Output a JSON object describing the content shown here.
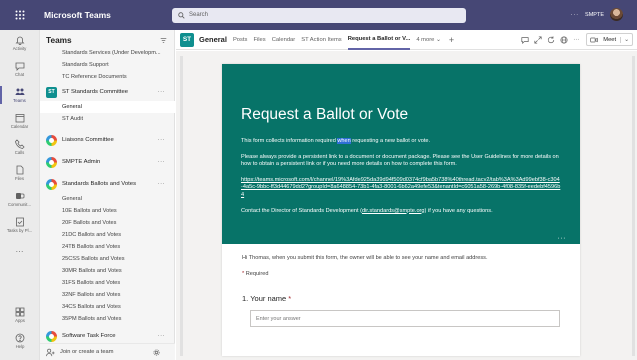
{
  "app": {
    "name": "Microsoft Teams"
  },
  "search": {
    "placeholder": "Search"
  },
  "titlebar": {
    "more": "···",
    "org": "SMPTE"
  },
  "rail": [
    {
      "label": "Activity"
    },
    {
      "label": "Chat"
    },
    {
      "label": "Teams"
    },
    {
      "label": "Calendar"
    },
    {
      "label": "Calls"
    },
    {
      "label": "Files"
    },
    {
      "label": "Communit..."
    },
    {
      "label": "Tasks by Pl..."
    },
    {
      "label": "···"
    }
  ],
  "rail_bottom": [
    {
      "label": "Apps"
    },
    {
      "label": "Help"
    }
  ],
  "panel": {
    "title": "Teams",
    "footer": "Join or create a team",
    "top_channels": [
      "Standards Services (Under Developm...",
      "Standards Support",
      "TC Reference Documents"
    ],
    "teams": [
      {
        "name": "ST Standards Committee",
        "avatar": "ST",
        "channels": [
          "General",
          "ST Audit"
        ],
        "selected": "General"
      },
      {
        "name": "Liaisons Committee",
        "channels": []
      },
      {
        "name": "SMPTE Admin",
        "channels": []
      },
      {
        "name": "Standards Ballots and Votes",
        "channels": [
          "General",
          "10E Ballots and Votes",
          "20F Ballots and Votes",
          "21DC Ballots and Votes",
          "24TB Ballots and Votes",
          "25CSS Ballots and Votes",
          "30MR Ballots and Votes",
          "31FS Ballots and Votes",
          "32NF Ballots and Votes",
          "34CS Ballots and Votes",
          "35PM Ballots and Votes"
        ]
      },
      {
        "name": "Software Task Force",
        "channels": []
      }
    ],
    "more": "···"
  },
  "channel": {
    "avatar": "ST",
    "name": "General",
    "tabs": [
      "Posts",
      "Files",
      "Calendar",
      "ST Action Items",
      "Request a Ballot or V...",
      "4 more"
    ],
    "active_tab": "Request a Ballot or V...",
    "meet": "Meet"
  },
  "form": {
    "title": "Request a Ballot or Vote",
    "desc_before": "This form collects information required ",
    "desc_highlight": "when",
    "desc_after": " requesting a new ballot or vote.",
    "para2": "Please always provide a persistent link to a document or document package. Please see the User Guidelines for more details on how to obtain a persistent link or if you need more details on how to complete this form.",
    "link": "https://teams.microsoft.com/l/channel/19%3Afde925da39d94f509d0374cf9ba5b738%40thread.tacv2/tab%3A%3Ad99ebf38-c304-4a5c-9bbc-ff3d44679dd2?groupId=8a648854-73b1-4fa3-8001-6b62a49efe53&tenantId=c6051a58-269b-4f08-835f-eedebf4596b4",
    "contact_before": "Contact the Director of Standards Development (",
    "contact_email": "dir.standards@smpte.org",
    "contact_after": ") if you have any questions.",
    "banner_more": "···",
    "intro": "Hi Thomas, when you submit this form, the owner will be able to see your name and email address.",
    "required": "Required",
    "question": "1. Your name",
    "answer_placeholder": "Enter your answer"
  }
}
